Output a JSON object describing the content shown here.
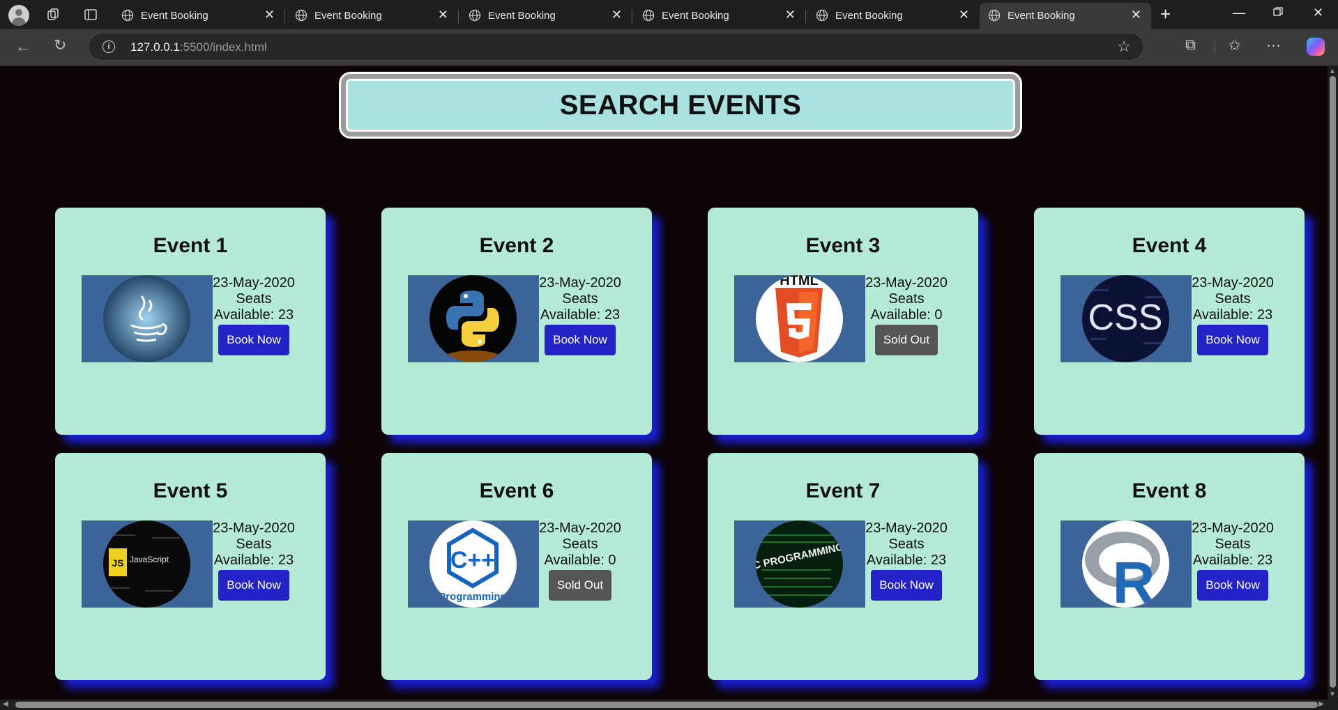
{
  "browser": {
    "tabs": [
      {
        "title": "Event Booking",
        "active": false
      },
      {
        "title": "Event Booking",
        "active": false
      },
      {
        "title": "Event Booking",
        "active": false
      },
      {
        "title": "Event Booking",
        "active": false
      },
      {
        "title": "Event Booking",
        "active": false
      },
      {
        "title": "Event Booking",
        "active": true
      }
    ],
    "url_host": "127.0.0.1",
    "url_rest": ":5500/index.html"
  },
  "page": {
    "search_label": "SEARCH EVENTS",
    "events": [
      {
        "title": "Event 1",
        "date": "23-May-2020",
        "seats_label": "Seats",
        "available": "Available: 23",
        "button": "Book Now",
        "status": "available",
        "icon": "java-logo-icon"
      },
      {
        "title": "Event 2",
        "date": "23-May-2020",
        "seats_label": "Seats",
        "available": "Available: 23",
        "button": "Book Now",
        "status": "available",
        "icon": "python-logo-icon"
      },
      {
        "title": "Event 3",
        "date": "23-May-2020",
        "seats_label": "Seats",
        "available": "Available: 0",
        "button": "Sold Out",
        "status": "sold",
        "icon": "html5-logo-icon"
      },
      {
        "title": "Event 4",
        "date": "23-May-2020",
        "seats_label": "Seats",
        "available": "Available: 23",
        "button": "Book Now",
        "status": "available",
        "icon": "css-logo-icon"
      },
      {
        "title": "Event 5",
        "date": "23-May-2020",
        "seats_label": "Seats",
        "available": "Available: 23",
        "button": "Book Now",
        "status": "available",
        "icon": "javascript-logo-icon"
      },
      {
        "title": "Event 6",
        "date": "23-May-2020",
        "seats_label": "Seats",
        "available": "Available: 0",
        "button": "Sold Out",
        "status": "sold",
        "icon": "cpp-logo-icon"
      },
      {
        "title": "Event 7",
        "date": "23-May-2020",
        "seats_label": "Seats",
        "available": "Available: 23",
        "button": "Book Now",
        "status": "available",
        "icon": "c-programming-logo-icon"
      },
      {
        "title": "Event 8",
        "date": "23-May-2020",
        "seats_label": "Seats",
        "available": "Available: 23",
        "button": "Book Now",
        "status": "available",
        "icon": "r-logo-icon"
      }
    ],
    "logo_text": {
      "html5": "HTML",
      "css": "CSS",
      "javascript": "JavaScript",
      "js": "JS",
      "cpp": "C++",
      "cpp_caption": "Programming",
      "c_programming": "C PROGRAMMING",
      "r": "R"
    }
  },
  "colors": {
    "page_bg": "#0d0406",
    "card_bg": "#b5ead7",
    "card_shadow": "#1a1fcf",
    "book_button": "#2323c7",
    "sold_button": "#555555",
    "search_bg": "#a9e1e1",
    "thumb_bg": "#3d6498"
  }
}
